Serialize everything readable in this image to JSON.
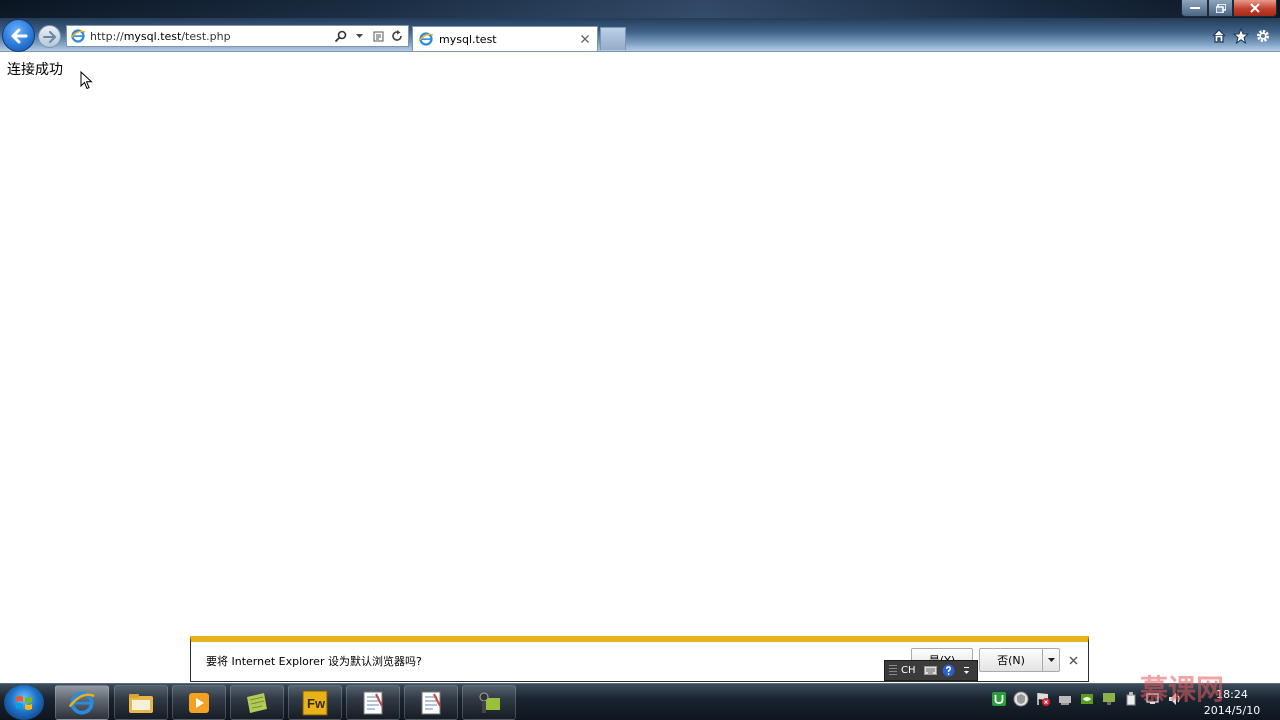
{
  "browser": {
    "address": {
      "prefix": "http://",
      "host": "mysql.test",
      "path": "/test.php"
    },
    "tab": {
      "title": "mysql.test"
    }
  },
  "page": {
    "message": "连接成功"
  },
  "notification": {
    "text": "要将 Internet Explorer 设为默认浏览器吗?",
    "yes_label": "是(Y)",
    "no_label": "否(N)"
  },
  "ime": {
    "label": "CH"
  },
  "taskbar": {
    "apps": [
      {
        "name": "internet-explorer",
        "active": true
      },
      {
        "name": "file-explorer"
      },
      {
        "name": "media-player"
      },
      {
        "name": "document-app"
      },
      {
        "name": "fireworks",
        "label": "Fw"
      },
      {
        "name": "notepad"
      },
      {
        "name": "notepad"
      },
      {
        "name": "video-app"
      }
    ],
    "clock": {
      "time": "18:24",
      "date": "2014/5/10"
    }
  },
  "watermark": {
    "text": "慕课网"
  },
  "colors": {
    "notify_accent": "#e8b319",
    "close_button": "#c4402c",
    "back_button": "#2a79d8"
  }
}
